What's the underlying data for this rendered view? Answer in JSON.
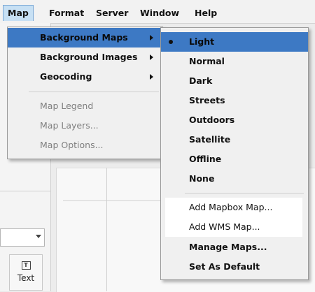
{
  "menubar": {
    "items": [
      {
        "label": "Map"
      },
      {
        "label": "Format"
      },
      {
        "label": "Server"
      },
      {
        "label": "Window"
      },
      {
        "label": "Help"
      }
    ]
  },
  "map_menu": {
    "items": [
      {
        "label": "Background Maps",
        "state": "highlighted",
        "submenu": true
      },
      {
        "label": "Background Images",
        "state": "enabled",
        "submenu": true
      },
      {
        "label": "Geocoding",
        "state": "enabled",
        "submenu": true
      },
      {
        "label": "Map Legend",
        "state": "disabled"
      },
      {
        "label": "Map Layers...",
        "state": "disabled"
      },
      {
        "label": "Map Options...",
        "state": "disabled"
      }
    ]
  },
  "background_maps_submenu": {
    "styles": [
      {
        "label": "Light",
        "checked": true
      },
      {
        "label": "Normal"
      },
      {
        "label": "Dark"
      },
      {
        "label": "Streets"
      },
      {
        "label": "Outdoors"
      },
      {
        "label": "Satellite"
      },
      {
        "label": "Offline"
      },
      {
        "label": "None"
      }
    ],
    "actions": [
      {
        "label": "Add Mapbox Map..."
      },
      {
        "label": "Add WMS Map..."
      },
      {
        "label": "Manage Maps..."
      },
      {
        "label": "Set As Default"
      }
    ]
  },
  "toolbar": {
    "text_tool_label": "Text",
    "text_tool_icon": "T"
  },
  "colors": {
    "highlight": "#3d79c4",
    "menu_background": "#f0f0f0",
    "active_menubar": "#c7e0f4"
  }
}
